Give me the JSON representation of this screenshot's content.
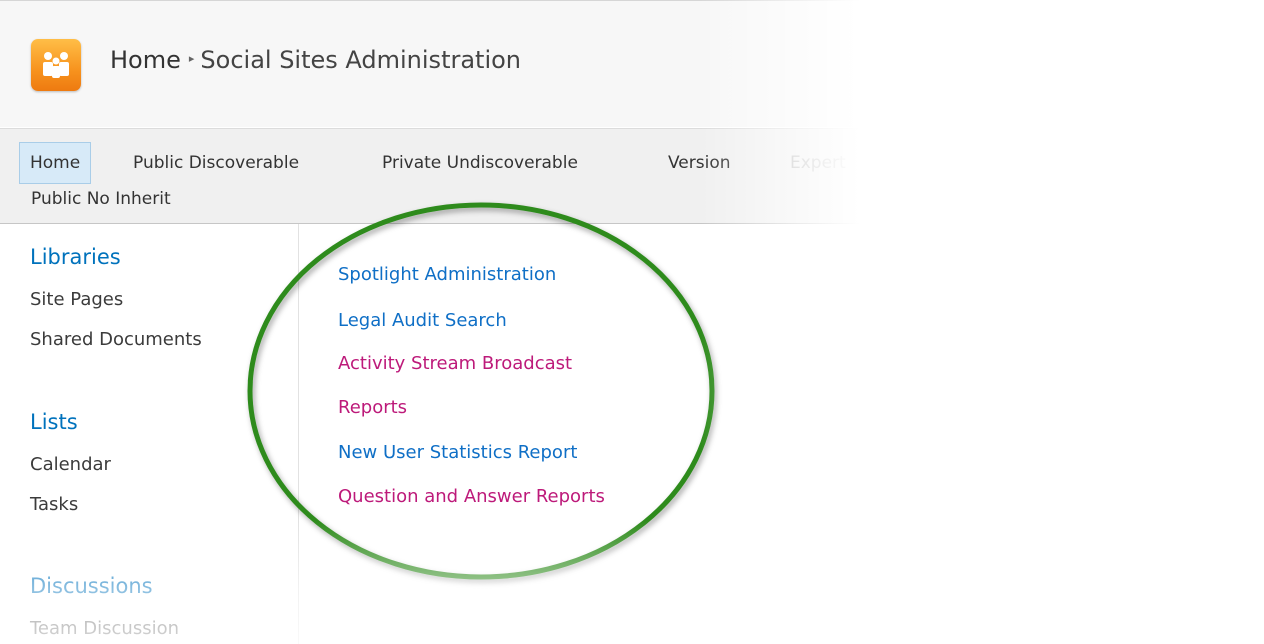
{
  "header": {
    "logo_icon": "people-group-icon",
    "breadcrumb_home": "Home",
    "breadcrumb_separator": "▸",
    "page_title": "Social Sites Administration",
    "logo_color": "#f7931e"
  },
  "topnav": {
    "items": [
      {
        "label": "Home",
        "selected": true
      },
      {
        "label": "Public Discoverable"
      },
      {
        "label": "Private Undiscoverable"
      },
      {
        "label": "Version"
      },
      {
        "label": "Expert"
      },
      {
        "label": "Public No Inherit"
      }
    ]
  },
  "leftnav": {
    "sections": [
      {
        "heading": "Libraries",
        "items": [
          "Site Pages",
          "Shared Documents"
        ]
      },
      {
        "heading": "Lists",
        "items": [
          "Calendar",
          "Tasks"
        ]
      },
      {
        "heading": "Discussions",
        "items": [
          "Team Discussion"
        ]
      }
    ]
  },
  "content": {
    "links": [
      {
        "label": "Spotlight Administration",
        "color": "#0f6fc6"
      },
      {
        "label": "Legal Audit Search",
        "color": "#0f6fc6"
      },
      {
        "label": "Activity Stream Broadcast",
        "color": "#bd1a7a"
      },
      {
        "label": "Reports",
        "color": "#bd1a7a"
      },
      {
        "label": "New User Statistics Report",
        "color": "#0f6fc6"
      },
      {
        "label": "Question and Answer Reports",
        "color": "#bd1a7a"
      }
    ]
  },
  "annotation": {
    "shape": "ellipse",
    "color": "#2e8b1e"
  },
  "theme": {
    "link_blue": "#0f6fc6",
    "link_magenta": "#bd1a7a",
    "heading_blue": "#0072bc"
  }
}
